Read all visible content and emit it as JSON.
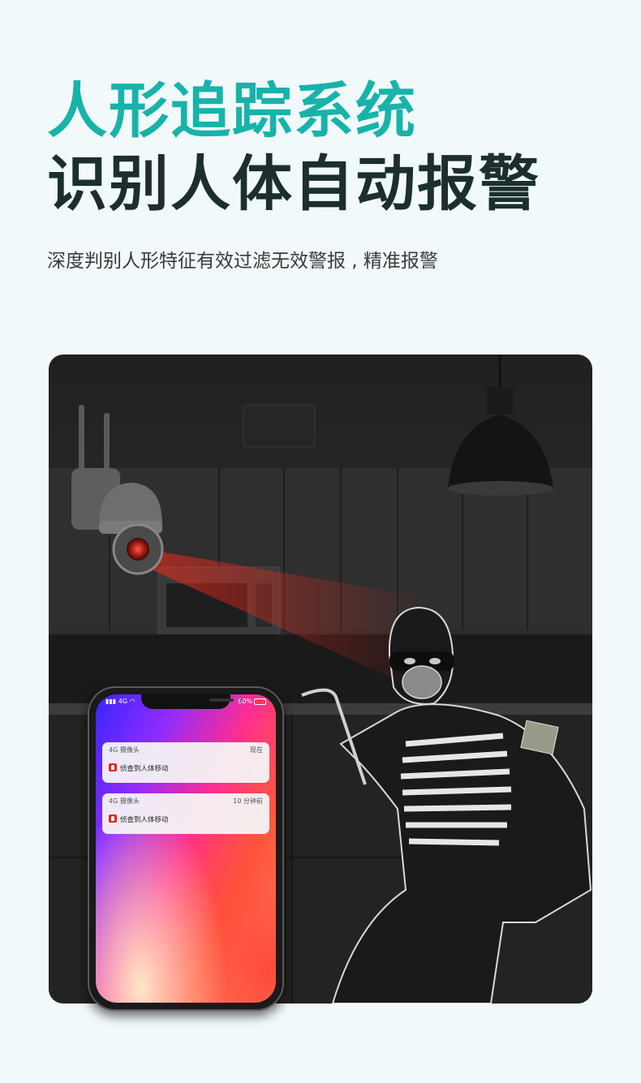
{
  "title_line1": "人形追踪系统",
  "title_line2": "识别人体自动报警",
  "subtitle": "深度判别人形特征有效过滤无效警报 , 精准报警",
  "colors": {
    "accent": "#17b3aa",
    "title_dark": "#1c2f2c",
    "alert_red": "#e5261d"
  },
  "phone": {
    "status_left": "4G",
    "battery": "60%",
    "notifications": [
      {
        "app": "4G 摄像头",
        "time": "现在",
        "message": "侦查到人体移动",
        "icon": "alarm-icon"
      },
      {
        "app": "4G 摄像头",
        "time": "10 分钟前",
        "message": "侦查到人体移动",
        "icon": "alarm-icon"
      }
    ]
  }
}
